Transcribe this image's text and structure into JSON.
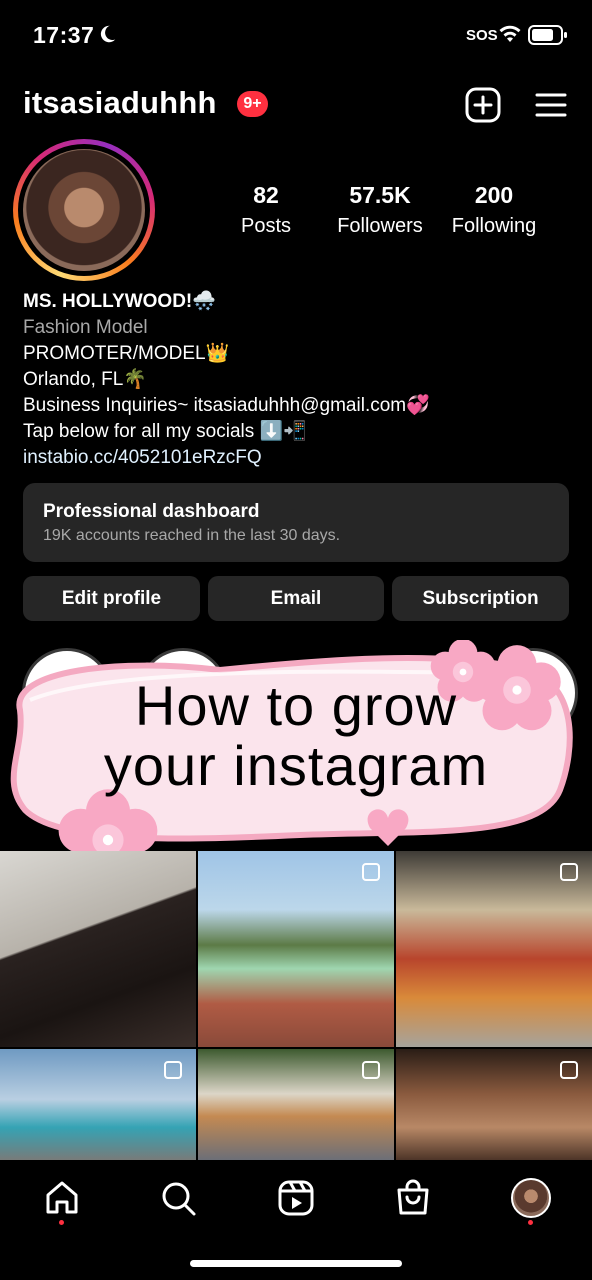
{
  "status_bar": {
    "time": "17:37",
    "carrier": "SOS"
  },
  "header": {
    "username": "itsasiaduhhh",
    "notification_badge": "9+"
  },
  "stats": [
    {
      "value": "82",
      "label": "Posts"
    },
    {
      "value": "57.5K",
      "label": "Followers"
    },
    {
      "value": "200",
      "label": "Following"
    }
  ],
  "bio": {
    "name": "MS. HOLLYWOOD!🌨️",
    "category": "Fashion Model",
    "lines": [
      "PROMOTER/MODEL👑",
      "Orlando, FL🌴",
      "Business Inquiries~ itsasiaduhhh@gmail.com💞",
      "Tap below for all my socials ⬇️📲"
    ],
    "link": "instabio.cc/4052101eRzcFQ"
  },
  "dashboard": {
    "title": "Professional dashboard",
    "subtitle": "19K accounts reached in the last 30 days."
  },
  "buttons": {
    "edit": "Edit profile",
    "email": "Email",
    "subscription": "Subscription"
  },
  "overlay": {
    "line1": "How to grow",
    "line2": "your instagram"
  },
  "colors": {
    "accent_red": "#ff3040",
    "button_bg": "#262626",
    "link": "#e0f1ff"
  },
  "icons": [
    "moon-icon",
    "wifi-icon",
    "battery-icon",
    "add-post-icon",
    "menu-icon",
    "home-icon",
    "search-icon",
    "reels-icon",
    "shop-icon",
    "profile-avatar-icon"
  ]
}
